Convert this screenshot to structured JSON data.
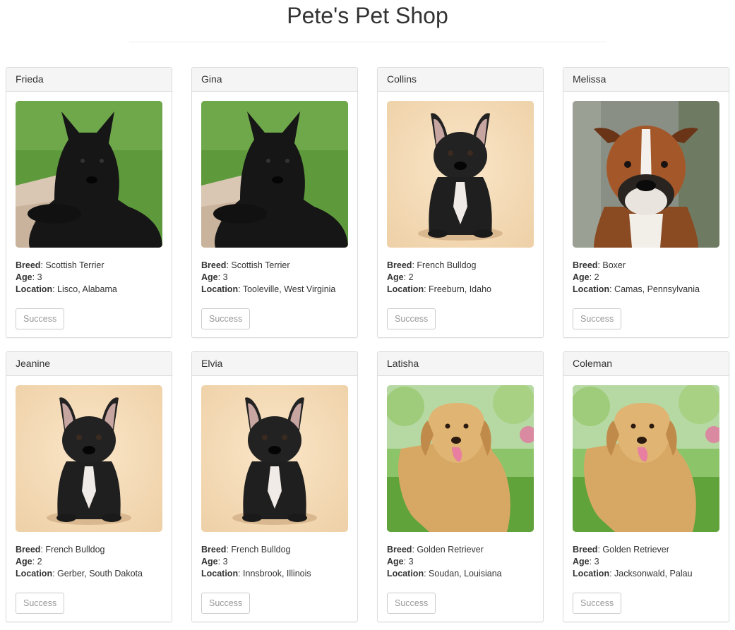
{
  "header": {
    "title": "Pete's Pet Shop"
  },
  "labels": {
    "breed": "Breed",
    "age": "Age",
    "location": "Location"
  },
  "pets": [
    {
      "name": "Frieda",
      "breed": "Scottish Terrier",
      "age": "3",
      "location": "Lisco, Alabama",
      "image": "scottish-terrier-photo",
      "button": "Success"
    },
    {
      "name": "Gina",
      "breed": "Scottish Terrier",
      "age": "3",
      "location": "Tooleville, West Virginia",
      "image": "scottish-terrier-photo",
      "button": "Success"
    },
    {
      "name": "Collins",
      "breed": "French Bulldog",
      "age": "2",
      "location": "Freeburn, Idaho",
      "image": "french-bulldog-photo",
      "button": "Success"
    },
    {
      "name": "Melissa",
      "breed": "Boxer",
      "age": "2",
      "location": "Camas, Pennsylvania",
      "image": "boxer-photo",
      "button": "Success"
    },
    {
      "name": "Jeanine",
      "breed": "French Bulldog",
      "age": "2",
      "location": "Gerber, South Dakota",
      "image": "french-bulldog-photo",
      "button": "Success"
    },
    {
      "name": "Elvia",
      "breed": "French Bulldog",
      "age": "3",
      "location": "Innsbrook, Illinois",
      "image": "french-bulldog-photo",
      "button": "Success"
    },
    {
      "name": "Latisha",
      "breed": "Golden Retriever",
      "age": "3",
      "location": "Soudan, Louisiana",
      "image": "golden-retriever-photo",
      "button": "Success"
    },
    {
      "name": "Coleman",
      "breed": "Golden Retriever",
      "age": "3",
      "location": "Jacksonwald, Palau",
      "image": "golden-retriever-photo",
      "button": "Success"
    }
  ]
}
